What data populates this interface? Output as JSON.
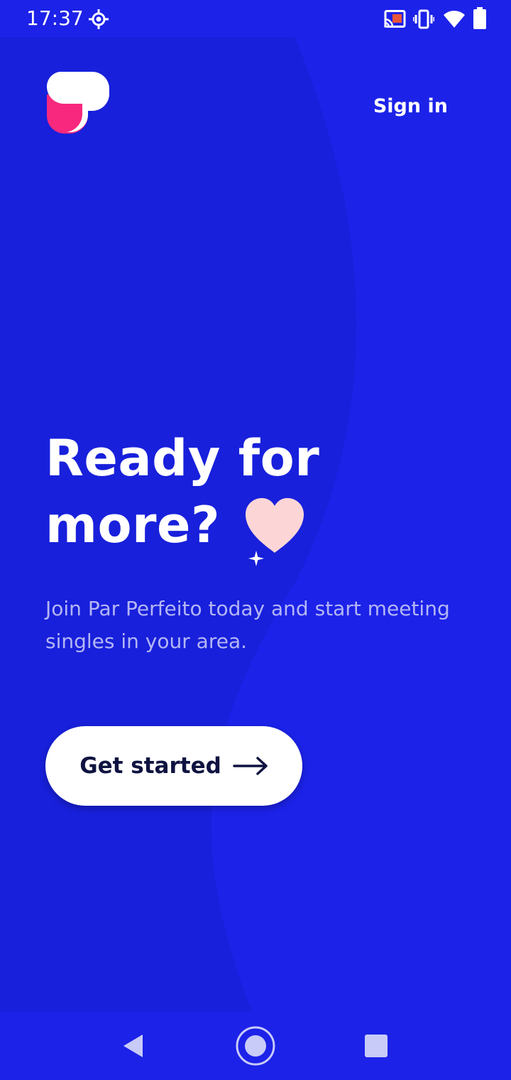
{
  "status_bar": {
    "time": "17:37",
    "icons": [
      "location-target-icon",
      "cast-icon",
      "vibrate-icon",
      "wifi-icon",
      "battery-icon"
    ]
  },
  "header": {
    "logo_icon": "par-perfeito-logo-icon",
    "sign_in_label": "Sign in"
  },
  "hero": {
    "headline_line1": "Ready for",
    "headline_line2": "more?",
    "heart_icon": "heart-icon",
    "subtitle": "Join Par Perfeito today and start meeting singles in your area.",
    "cta_label": "Get started",
    "cta_icon": "arrow-right-icon"
  },
  "nav_bar": {
    "buttons": [
      "back-icon",
      "home-icon",
      "recents-icon"
    ]
  },
  "colors": {
    "background": "#1c22e8",
    "background_shape": "#1820db",
    "heart": "#fcd6d6",
    "logo_pink": "#f7287e",
    "text_primary": "#ffffff",
    "text_secondary": "#b4b6f5",
    "button_text": "#0f1340"
  }
}
